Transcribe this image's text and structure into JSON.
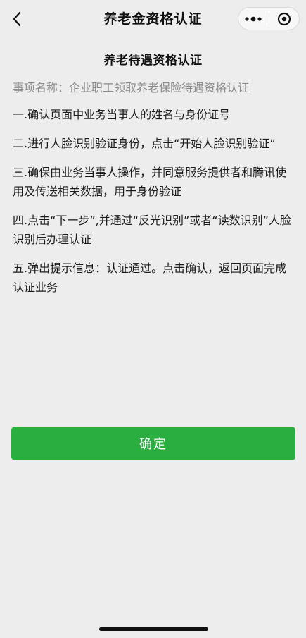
{
  "nav": {
    "title": "养老金资格认证"
  },
  "card": {
    "title": "养老待遇资格认证",
    "subject": "事项名称：企业职工领取养老保险待遇资格认证"
  },
  "steps": [
    "一.确认页面中业务当事人的姓名与身份证号",
    "二.进行人脸识别验证身份，点击“开始人脸识别验证”",
    "三.确保由业务当事人操作，并同意服务提供者和腾讯使用及传送相关数据，用于身份验证",
    "四.点击“下一步”,并通过“反光识别”或者“读数识别”人脸识别后办理认证",
    "五.弹出提示信息：认证通过。点击确认，返回页面完成认证业务"
  ],
  "actions": {
    "confirm_label": "确定"
  },
  "icons": {
    "back": "chevron-left-icon",
    "more": "more-dots-icon",
    "close": "target-circle-icon"
  },
  "colors": {
    "background": "#ededed",
    "primary": "#2aae40",
    "muted_text": "#8a8a8a"
  }
}
